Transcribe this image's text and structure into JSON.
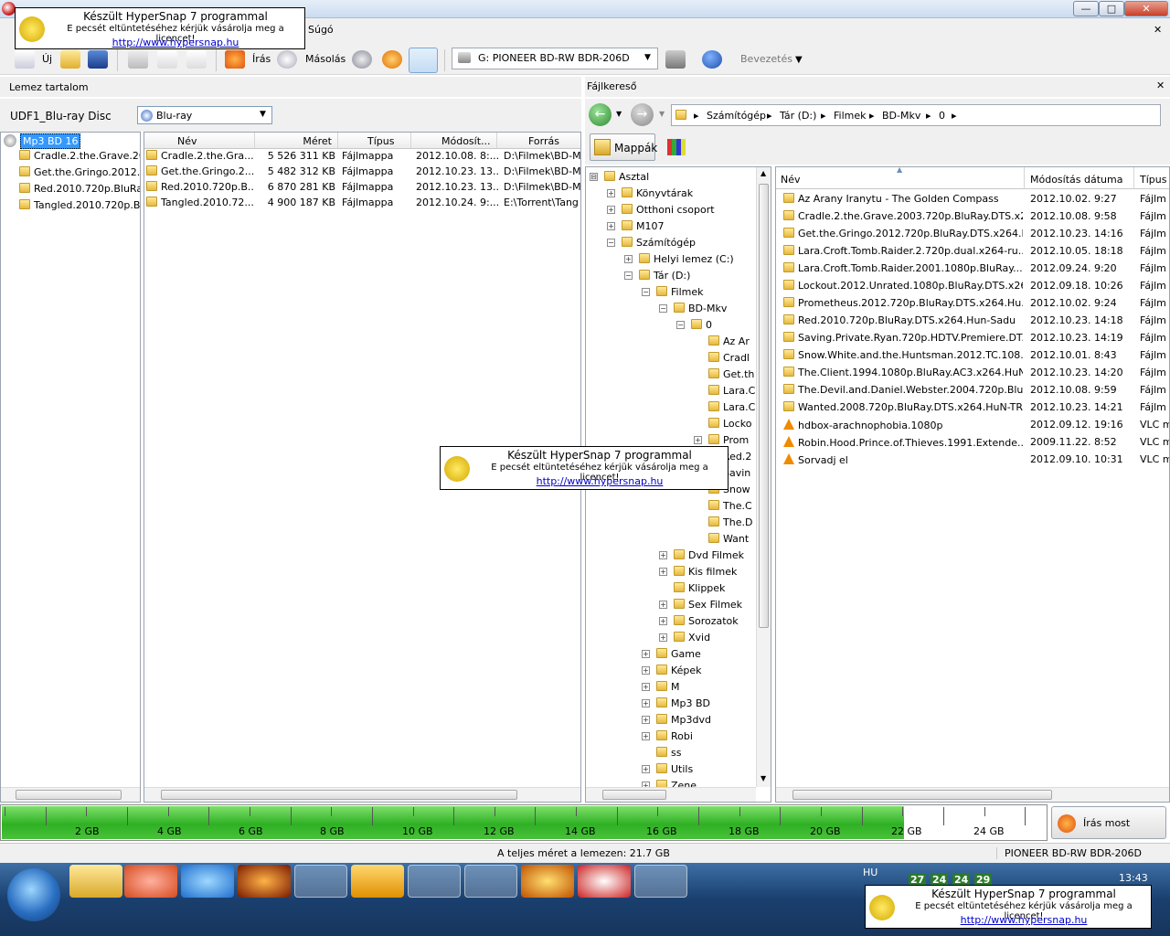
{
  "window": {
    "close_label": "✕",
    "min_label": "—",
    "max_label": "□"
  },
  "menu": {
    "help": "Súgó"
  },
  "toolbar": {
    "new": "Új",
    "write": "Írás",
    "copy": "Másolás",
    "intro": "Bevezetés",
    "drive": "G: PIONEER BD-RW   BDR-206D"
  },
  "left": {
    "header": "Lemez tartalom",
    "disc_label": "UDF1_Blu-ray Disc",
    "disc_type": "Blu-ray",
    "tree_root": "Mp3 BD 16",
    "tree_items": [
      "Cradle.2.the.Grave.20",
      "Get.the.Gringo.2012.7",
      "Red.2010.720p.BluRay",
      "Tangled.2010.720p.Bl"
    ],
    "columns": [
      "Név",
      "Méret",
      "Típus",
      "Módosít...",
      "Forrás"
    ],
    "rows": [
      {
        "name": "Cradle.2.the.Gra...",
        "size": "5 526 311 KB",
        "type": "Fájlmappa",
        "date": "2012.10.08. 8:...",
        "src": "D:\\Filmek\\BD-M"
      },
      {
        "name": "Get.the.Gringo.2...",
        "size": "5 482 312 KB",
        "type": "Fájlmappa",
        "date": "2012.10.23. 13...",
        "src": "D:\\Filmek\\BD-M"
      },
      {
        "name": "Red.2010.720p.B...",
        "size": "6 870 281 KB",
        "type": "Fájlmappa",
        "date": "2012.10.23. 13...",
        "src": "D:\\Filmek\\BD-M"
      },
      {
        "name": "Tangled.2010.72...",
        "size": "4 900 187 KB",
        "type": "Fájlmappa",
        "date": "2012.10.24. 9:...",
        "src": "E:\\Torrent\\Tang"
      }
    ]
  },
  "right": {
    "header": "Fájlkereső",
    "breadcrumb": [
      "Számítógép",
      "Tár (D:)",
      "Filmek",
      "BD-Mkv",
      "0"
    ],
    "folders_tab": "Mappák",
    "tree": [
      {
        "label": "Asztal",
        "indent": 0,
        "exp": "⊟"
      },
      {
        "label": "Könyvtárak",
        "indent": 1,
        "exp": "+"
      },
      {
        "label": "Otthoni csoport",
        "indent": 1,
        "exp": "+"
      },
      {
        "label": "M107",
        "indent": 1,
        "exp": "+"
      },
      {
        "label": "Számítógép",
        "indent": 1,
        "exp": "−"
      },
      {
        "label": "Helyi lemez (C:)",
        "indent": 2,
        "exp": "+"
      },
      {
        "label": "Tár (D:)",
        "indent": 2,
        "exp": "−"
      },
      {
        "label": "Filmek",
        "indent": 3,
        "exp": "−"
      },
      {
        "label": "BD-Mkv",
        "indent": 4,
        "exp": "−"
      },
      {
        "label": "0",
        "indent": 5,
        "exp": "−"
      },
      {
        "label": "Az Ar",
        "indent": 6,
        "exp": ""
      },
      {
        "label": "Cradl",
        "indent": 6,
        "exp": ""
      },
      {
        "label": "Get.th",
        "indent": 6,
        "exp": ""
      },
      {
        "label": "Lara.C",
        "indent": 6,
        "exp": ""
      },
      {
        "label": "Lara.C",
        "indent": 6,
        "exp": ""
      },
      {
        "label": "Locko",
        "indent": 6,
        "exp": ""
      },
      {
        "label": "Prom",
        "indent": 6,
        "exp": "+"
      },
      {
        "label": "Red.2",
        "indent": 6,
        "exp": ""
      },
      {
        "label": "Savin",
        "indent": 6,
        "exp": ""
      },
      {
        "label": "Snow",
        "indent": 6,
        "exp": ""
      },
      {
        "label": "The.C",
        "indent": 6,
        "exp": ""
      },
      {
        "label": "The.D",
        "indent": 6,
        "exp": ""
      },
      {
        "label": "Want",
        "indent": 6,
        "exp": ""
      },
      {
        "label": "Dvd Filmek",
        "indent": 4,
        "exp": "+"
      },
      {
        "label": "Kis filmek",
        "indent": 4,
        "exp": "+"
      },
      {
        "label": "Klippek",
        "indent": 4,
        "exp": ""
      },
      {
        "label": "Sex Filmek",
        "indent": 4,
        "exp": "+"
      },
      {
        "label": "Sorozatok",
        "indent": 4,
        "exp": "+"
      },
      {
        "label": "Xvid",
        "indent": 4,
        "exp": "+"
      },
      {
        "label": "Game",
        "indent": 3,
        "exp": "+"
      },
      {
        "label": "Képek",
        "indent": 3,
        "exp": "+"
      },
      {
        "label": "M",
        "indent": 3,
        "exp": "+"
      },
      {
        "label": "Mp3 BD",
        "indent": 3,
        "exp": "+"
      },
      {
        "label": "Mp3dvd",
        "indent": 3,
        "exp": "+"
      },
      {
        "label": "Robi",
        "indent": 3,
        "exp": "+"
      },
      {
        "label": "ss",
        "indent": 3,
        "exp": ""
      },
      {
        "label": "Utils",
        "indent": 3,
        "exp": "+"
      },
      {
        "label": "Zene",
        "indent": 3,
        "exp": "+"
      }
    ],
    "columns": [
      "Név",
      "Módosítás dátuma",
      "Típus"
    ],
    "files": [
      {
        "name": "Az Arany Iranytu - The Golden Compass",
        "date": "2012.10.02. 9:27",
        "type": "Fájlm",
        "kind": "folder"
      },
      {
        "name": "Cradle.2.the.Grave.2003.720p.BluRay.DTS.x2...",
        "date": "2012.10.08. 9:58",
        "type": "Fájlm",
        "kind": "folder"
      },
      {
        "name": "Get.the.Gringo.2012.720p.BluRay.DTS.x264.H...",
        "date": "2012.10.23. 14:16",
        "type": "Fájlm",
        "kind": "folder"
      },
      {
        "name": "Lara.Croft.Tomb.Raider.2.720p.dual.x264-ru...",
        "date": "2012.10.05. 18:18",
        "type": "Fájlm",
        "kind": "folder"
      },
      {
        "name": "Lara.Croft.Tomb.Raider.2001.1080p.BluRay....",
        "date": "2012.09.24. 9:20",
        "type": "Fájlm",
        "kind": "folder"
      },
      {
        "name": "Lockout.2012.Unrated.1080p.BluRay.DTS.x26...",
        "date": "2012.09.18. 10:26",
        "type": "Fájlm",
        "kind": "folder"
      },
      {
        "name": "Prometheus.2012.720p.BluRay.DTS.x264.Hu...",
        "date": "2012.10.02. 9:24",
        "type": "Fájlm",
        "kind": "folder"
      },
      {
        "name": "Red.2010.720p.BluRay.DTS.x264.Hun-Sadu",
        "date": "2012.10.23. 14:18",
        "type": "Fájlm",
        "kind": "folder"
      },
      {
        "name": "Saving.Private.Ryan.720p.HDTV.Premiere.DT...",
        "date": "2012.10.23. 14:19",
        "type": "Fájlm",
        "kind": "folder"
      },
      {
        "name": "Snow.White.and.the.Huntsman.2012.TC.108...",
        "date": "2012.10.01. 8:43",
        "type": "Fájlm",
        "kind": "folder"
      },
      {
        "name": "The.Client.1994.1080p.BluRay.AC3.x264.HuN...",
        "date": "2012.10.23. 14:20",
        "type": "Fájlm",
        "kind": "folder"
      },
      {
        "name": "The.Devil.and.Daniel.Webster.2004.720p.Blu...",
        "date": "2012.10.08. 9:59",
        "type": "Fájlm",
        "kind": "folder"
      },
      {
        "name": "Wanted.2008.720p.BluRay.DTS.x264.HuN-TR...",
        "date": "2012.10.23. 14:21",
        "type": "Fájlm",
        "kind": "folder"
      },
      {
        "name": "hdbox-arachnophobia.1080p",
        "date": "2012.09.12. 19:16",
        "type": "VLC m",
        "kind": "vlc"
      },
      {
        "name": "Robin.Hood.Prince.of.Thieves.1991.Extende...",
        "date": "2009.11.22. 8:52",
        "type": "VLC m",
        "kind": "vlc"
      },
      {
        "name": "Sorvadj el",
        "date": "2012.09.10. 10:31",
        "type": "VLC m",
        "kind": "vlc"
      }
    ]
  },
  "capacity": {
    "fill_fraction": 0.863,
    "ticks": [
      "2 GB",
      "4 GB",
      "6 GB",
      "8 GB",
      "10 GB",
      "12 GB",
      "14 GB",
      "16 GB",
      "18 GB",
      "20 GB",
      "22 GB",
      "24 GB"
    ],
    "burn_label": "Írás most"
  },
  "status": {
    "total": "A teljes méret a lemezen: 21.7 GB",
    "drive": "PIONEER  BD-RW   BDR-206D"
  },
  "taskbar": {
    "lang": "HU",
    "clock": "13:43",
    "tray_numbers": [
      "27",
      "24",
      "24",
      "29"
    ]
  },
  "watermark": {
    "line1": "Készült HyperSnap 7 programmal",
    "line2": "E pecsét eltüntetéséhez kérjük vásárolja meg a licencet!",
    "link": "http://www.hypersnap.hu"
  }
}
